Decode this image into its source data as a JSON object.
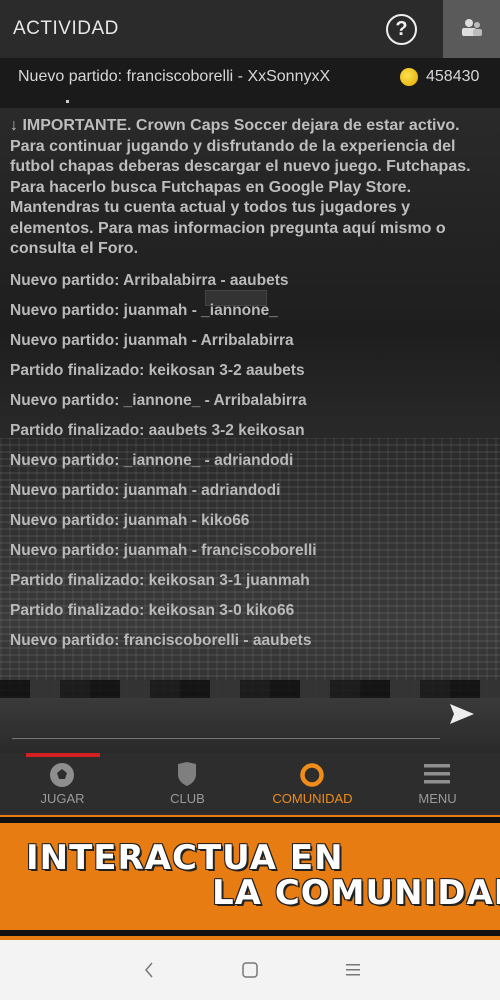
{
  "header": {
    "title": "ACTIVIDAD",
    "help_icon": "question-circle-icon",
    "profile_icon": "users-icon"
  },
  "status": {
    "match": "Nuevo partido: franciscoborelli - XxSonnyxX",
    "coins": "458430"
  },
  "feed": {
    "important": "↓ IMPORTANTE. Crown Caps Soccer dejara de estar activo. Para continuar jugando y disfrutando de la experiencia del futbol chapas deberas descargar el nuevo juego. Futchapas. Para hacerlo busca Futchapas en Google Play Store. Mantendras tu cuenta actual y todos tus jugadores y elementos. Para mas informacion pregunta aquí mismo o consulta el Foro.",
    "items": [
      "Nuevo partido: Arribalabirra - aaubets",
      "Nuevo partido: juanmah - _iannone_",
      "Nuevo partido: juanmah - Arribalabirra",
      "Partido finalizado: keikosan 3-2 aaubets",
      "Nuevo partido: _iannone_ - Arribalabirra",
      "Partido finalizado: aaubets 3-2 keikosan",
      "Nuevo partido: _iannone_ - adriandodi",
      "Nuevo partido: juanmah - adriandodi",
      "Nuevo partido: juanmah - kiko66",
      "Nuevo partido: juanmah - franciscoborelli",
      "Partido finalizado: keikosan 3-1 juanmah",
      "Partido finalizado: keikosan 3-0 kiko66",
      "Nuevo partido: franciscoborelli - aaubets"
    ]
  },
  "nav": {
    "jugar": "JUGAR",
    "club": "CLUB",
    "comunidad": "COMUNIDAD",
    "menu": "MENU"
  },
  "banner": {
    "line1": "INTERACTUA EN",
    "line2": "LA COMUNIDAD"
  },
  "colors": {
    "accent": "#f08c1a",
    "banner": "#e77c12",
    "indicator": "#d32020"
  }
}
